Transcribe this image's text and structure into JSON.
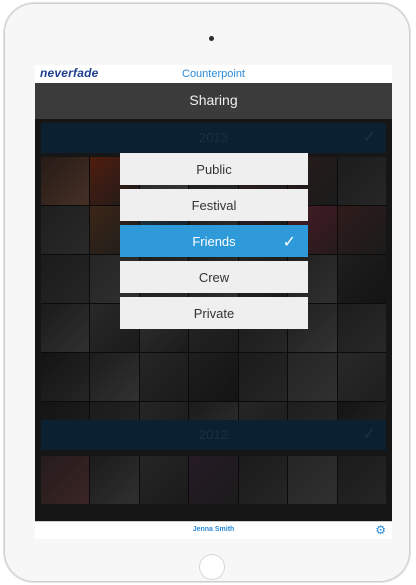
{
  "app": {
    "logo": "neverfade",
    "title": "Counterpoint",
    "screen_title": "Sharing",
    "user_name": "Jenna Smith",
    "accent_color": "#2f9ad9"
  },
  "sections": [
    {
      "year": "2013",
      "checked_icon": "check-icon"
    },
    {
      "year": "2012",
      "checked_icon": "check-icon"
    }
  ],
  "share_options": [
    {
      "label": "Public",
      "selected": false
    },
    {
      "label": "Festival",
      "selected": false
    },
    {
      "label": "Friends",
      "selected": true
    },
    {
      "label": "Crew",
      "selected": false
    },
    {
      "label": "Private",
      "selected": false
    }
  ],
  "icons": {
    "settings": "gear-icon"
  }
}
